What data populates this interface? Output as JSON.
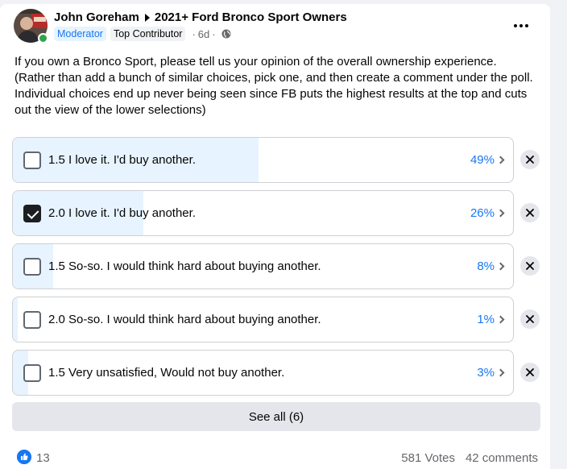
{
  "post": {
    "author": "John Goreham",
    "group": "2021+ Ford Bronco Sport Owners",
    "badges": [
      "Moderator",
      "Top Contributor"
    ],
    "time": "6d",
    "separator": "·",
    "privacy_icon": "globe-icon",
    "text": "If you own a Bronco Sport, please tell us your opinion of the overall ownership experience. (Rather than add a bunch of similar choices, pick one, and then create a comment under the poll. Individual choices end up never being seen since FB puts the highest results at the top and cuts out the view of the lower selections)"
  },
  "poll": {
    "options": [
      {
        "label": "1.5 I love it. I'd buy another.",
        "percent_label": "49%",
        "percent": 49,
        "checked": false
      },
      {
        "label": "2.0 I love it. I'd buy another.",
        "percent_label": "26%",
        "percent": 26,
        "checked": true
      },
      {
        "label": "1.5 So-so. I would think hard about buying another.",
        "percent_label": "8%",
        "percent": 8,
        "checked": false
      },
      {
        "label": "2.0 So-so. I would think hard about buying another.",
        "percent_label": "1%",
        "percent": 1,
        "checked": false
      },
      {
        "label": "1.5 Very unsatisfied, Would not buy another.",
        "percent_label": "3%",
        "percent": 3,
        "checked": false
      }
    ],
    "see_all_label": "See all (6)"
  },
  "footer": {
    "reaction_icon": "like-icon",
    "reaction_count": "13",
    "votes": "581 Votes",
    "comments": "42 comments"
  },
  "colors": {
    "accent": "#1877f2",
    "fill": "#e7f3ff",
    "online": "#31a24c"
  }
}
